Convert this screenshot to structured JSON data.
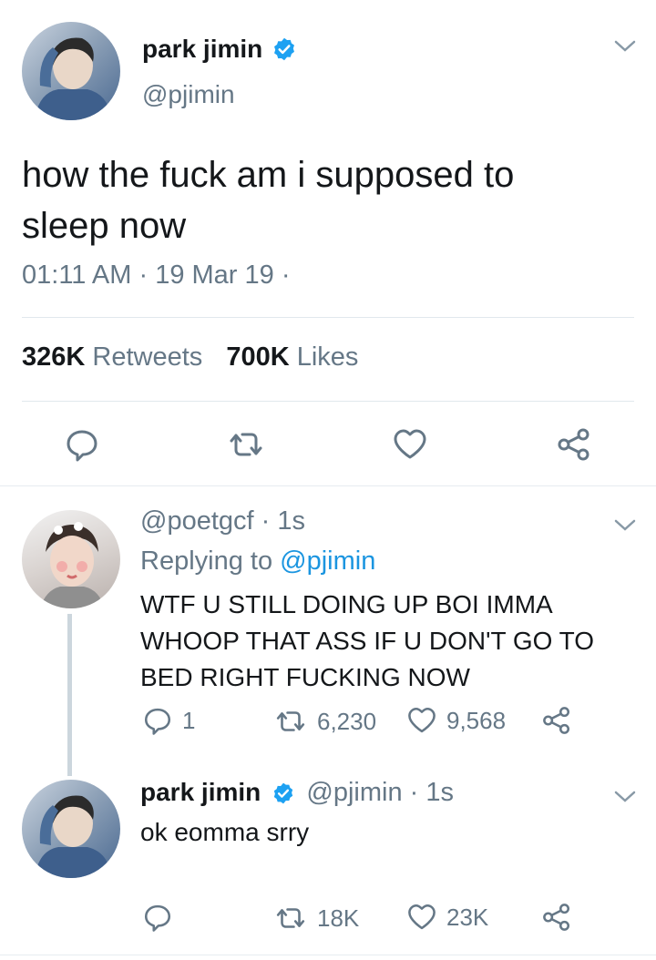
{
  "main_tweet": {
    "author_name": "park jimin",
    "author_handle": "@pjimin",
    "text_line1": "how the fuck am i supposed to",
    "text_line2": "sleep now",
    "time": "01:11 AM",
    "sep1": "·",
    "date": "19 Mar 19",
    "sep2": "·",
    "retweets_count": "326K",
    "retweets_label": "Retweets",
    "likes_count": "700K",
    "likes_label": "Likes"
  },
  "reply1": {
    "handle": "@poetgcf",
    "sep": "·",
    "time": "1s",
    "replying_to_label": "Replying to",
    "replying_to_handle": "@pjimin",
    "text_line1": "WTF U STILL DOING UP BOI IMMA",
    "text_line2": "WHOOP THAT ASS IF U DON'T GO TO",
    "text_line3": "BED RIGHT FUCKING NOW",
    "reply_count": "1",
    "retweet_count": "6,230",
    "like_count": "9,568"
  },
  "reply2": {
    "author_name": "park jimin",
    "handle": "@pjimin",
    "sep": "·",
    "time": "1s",
    "text": "ok eomma srry",
    "retweet_count": "18K",
    "like_count": "23K"
  },
  "colors": {
    "text": "#14171a",
    "muted": "#657786",
    "accent": "#1b95e0",
    "divider": "#e1e8ed"
  },
  "icons": [
    "verified-badge-icon",
    "chevron-down-icon",
    "reply-icon",
    "retweet-icon",
    "like-icon",
    "share-icon"
  ]
}
